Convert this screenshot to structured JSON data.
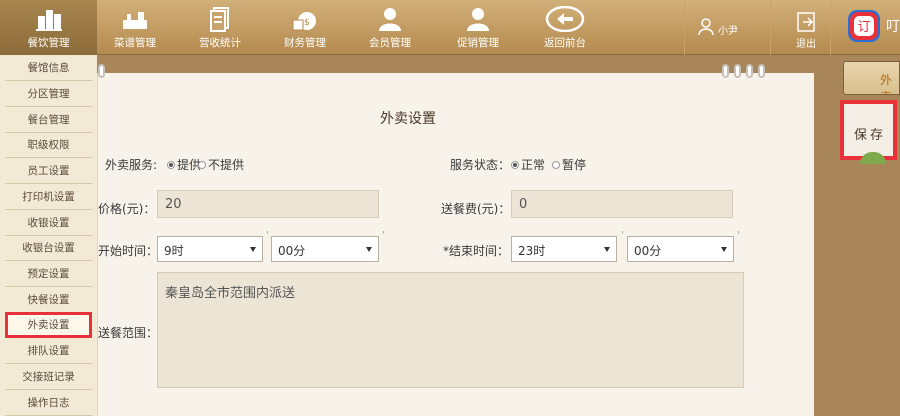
{
  "top_nav": {
    "items": [
      {
        "label": "餐饮管理",
        "icon": "buildings-icon"
      },
      {
        "label": "菜谱管理",
        "icon": "kitchen-icon"
      },
      {
        "label": "营收统计",
        "icon": "document-stack-icon"
      },
      {
        "label": "财务管理",
        "icon": "money-bag-icon"
      },
      {
        "label": "会员管理",
        "icon": "member-icon"
      },
      {
        "label": "促销管理",
        "icon": "promotion-user-icon"
      },
      {
        "label": "返回前台",
        "icon": "back-arrow-icon"
      }
    ],
    "active_index": 0,
    "user_label": "小尹",
    "exit_label": "退出",
    "brand_text": "叮",
    "brand_logo_text": "订"
  },
  "sidebar": {
    "items": [
      {
        "label": "餐馆信息"
      },
      {
        "label": "分区管理"
      },
      {
        "label": "餐台管理"
      },
      {
        "label": "职级权限"
      },
      {
        "label": "员工设置"
      },
      {
        "label": "打印机设置"
      },
      {
        "label": "收银设置"
      },
      {
        "label": "收银台设置"
      },
      {
        "label": "预定设置"
      },
      {
        "label": "快餐设置"
      },
      {
        "label": "外卖设置"
      },
      {
        "label": "排队设置"
      },
      {
        "label": "交接班记录"
      },
      {
        "label": "操作日志"
      }
    ],
    "highlighted_index": 10
  },
  "form": {
    "title": "外卖设置",
    "service_label": "外卖服务:",
    "service_options": [
      "提供",
      "不提供"
    ],
    "service_selected": "提供",
    "status_label": "服务状态：",
    "status_options": [
      "正常",
      "暂停"
    ],
    "status_selected": "正常",
    "price_label": "价格(元)：",
    "price_value": "20",
    "fee_label": "送餐费(元)：",
    "fee_value": "0",
    "start_label": "开始时间：",
    "start_hour": "9时",
    "start_minute": "00分",
    "end_label": "*结束时间：",
    "end_hour": "23时",
    "end_minute": "00分",
    "range_label": "送餐范围：",
    "range_value": "秦皇岛全市范围内派送"
  },
  "right_panel": {
    "tab_label": "外卖",
    "save_label": "保存"
  },
  "colors": {
    "topbar": "#c19a62",
    "highlight": "#e8313a",
    "paper": "#f7f2ea",
    "input_bg": "#ece5d6"
  }
}
